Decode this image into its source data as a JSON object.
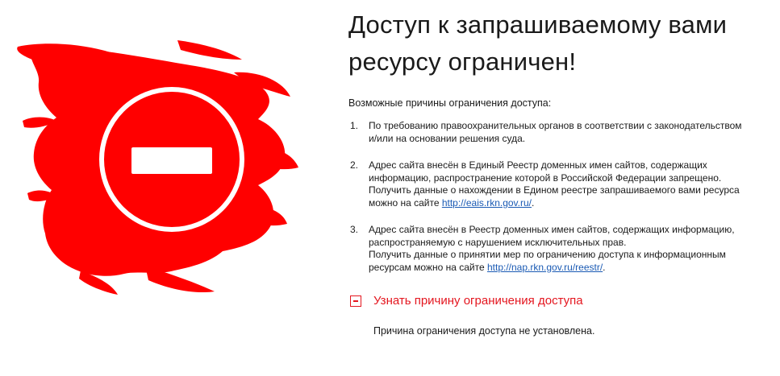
{
  "page": {
    "title_line1": "Доступ к запрашиваемому вами",
    "title_line2": "ресурсу ограничен!",
    "intro": "Возможные причины ограничения доступа:"
  },
  "reasons": [
    {
      "number": "1.",
      "line1": "По требованию правоохранительных органов в соответствии с законодательством",
      "line2": "и/или на основании решения суда."
    },
    {
      "number": "2.",
      "line1": "Адрес сайта внесён в Единый Реестр доменных имен сайтов, содержащих",
      "line2": "информацию, распространение которой в Российской Федерации запрещено.",
      "line3": "Получить данные о нахождении в Едином реестре запрашиваемого вами ресурса",
      "link_prefix": "можно на сайте ",
      "link_text": "http://eais.rkn.gov.ru/",
      "link_suffix": "."
    },
    {
      "number": "3.",
      "line1": "Адрес сайта внесён в Реестр доменных имен сайтов, содержащих информацию,",
      "line2": "распространяемую с нарушением исключительных прав.",
      "line3": "Получить данные о принятии мер по ограничению доступа к информационным",
      "link_prefix": "ресурсам можно на сайте ",
      "link_text": "http://nap.rkn.gov.ru/reestr/",
      "link_suffix": "."
    }
  ],
  "toggle": {
    "label": "Узнать причину ограничения доступа",
    "state": "expanded",
    "icon": "minus-box-icon"
  },
  "result": {
    "text": "Причина ограничения доступа не установлена."
  },
  "illustration": {
    "icon": "no-entry-icon",
    "brush_color": "#ff0000",
    "symbol_color": "#ffffff"
  },
  "colors": {
    "accent": "#e4161f",
    "link": "#1a5ab4",
    "text": "#1a1a1a"
  }
}
